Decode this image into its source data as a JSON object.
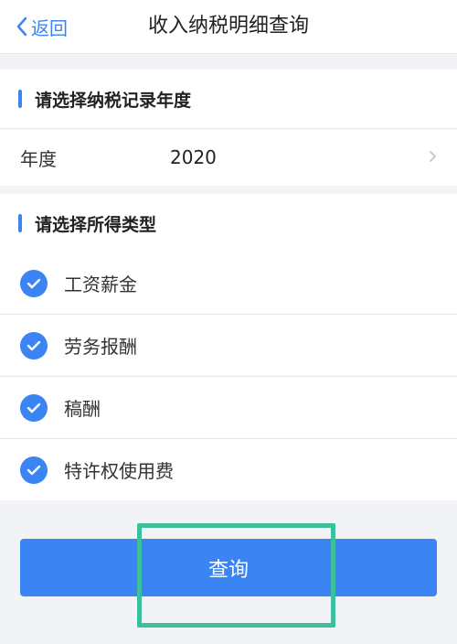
{
  "nav": {
    "back_label": "返回",
    "title": "收入纳税明细查询"
  },
  "year_section": {
    "heading": "请选择纳税记录年度",
    "field_label": "年度",
    "field_value": "2020"
  },
  "type_section": {
    "heading": "请选择所得类型",
    "items": [
      {
        "label": "工资薪金",
        "checked": true
      },
      {
        "label": "劳务报酬",
        "checked": true
      },
      {
        "label": "稿酬",
        "checked": true
      },
      {
        "label": "特许权使用费",
        "checked": true
      }
    ]
  },
  "actions": {
    "query_label": "查询"
  },
  "colors": {
    "accent": "#3a84f3",
    "highlight": "#3cbf9d"
  }
}
